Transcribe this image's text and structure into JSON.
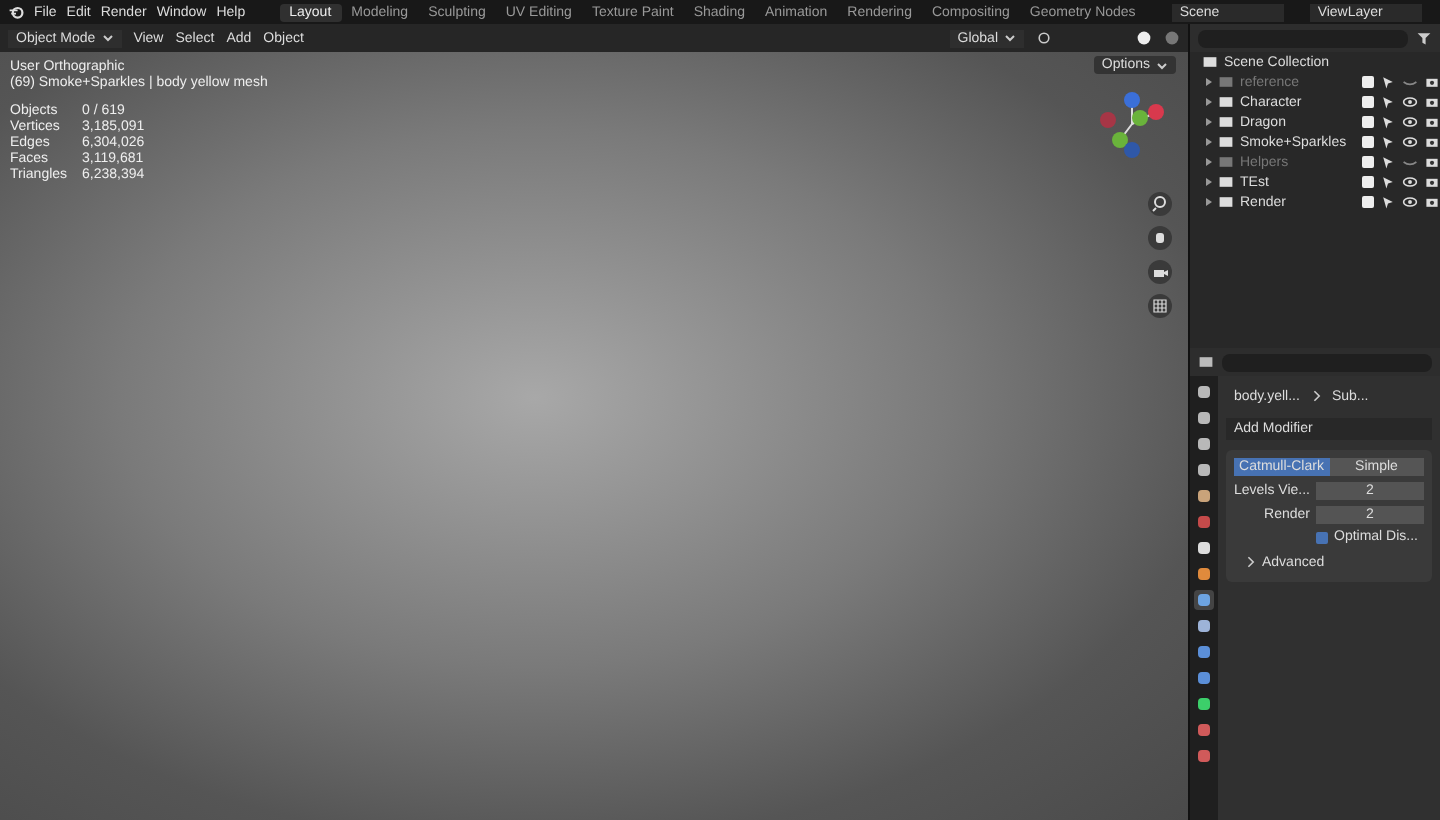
{
  "menu": [
    "File",
    "Edit",
    "Render",
    "Window",
    "Help"
  ],
  "workspaces": [
    {
      "label": "Layout",
      "selected": true
    },
    {
      "label": "Modeling",
      "selected": false
    },
    {
      "label": "Sculpting",
      "selected": false
    },
    {
      "label": "UV Editing",
      "selected": false
    },
    {
      "label": "Texture Paint",
      "selected": false
    },
    {
      "label": "Shading",
      "selected": false
    },
    {
      "label": "Animation",
      "selected": false
    },
    {
      "label": "Rendering",
      "selected": false
    },
    {
      "label": "Compositing",
      "selected": false
    },
    {
      "label": "Geometry Nodes",
      "selected": false
    }
  ],
  "scene": {
    "label": "Scene"
  },
  "view_layer": {
    "label": "ViewLayer"
  },
  "header": {
    "mode": "Object Mode",
    "menus": [
      "View",
      "Select",
      "Add",
      "Object"
    ],
    "orientation": "Global"
  },
  "viewport": {
    "view_name": "User Orthographic",
    "object_info": "(69) Smoke+Sparkles | body yellow mesh",
    "options": "Options",
    "stats": [
      {
        "label": "Objects",
        "value": "0 / 619"
      },
      {
        "label": "Vertices",
        "value": "3,185,091"
      },
      {
        "label": "Edges",
        "value": "6,304,026"
      },
      {
        "label": "Faces",
        "value": "3,119,681"
      },
      {
        "label": "Triangles",
        "value": "6,238,394"
      }
    ]
  },
  "outliner": {
    "root": "Scene Collection",
    "items": [
      {
        "name": "reference",
        "dimmed": true,
        "checked": true,
        "visible": false
      },
      {
        "name": "Character",
        "dimmed": false,
        "checked": true,
        "visible": true
      },
      {
        "name": "Dragon",
        "dimmed": false,
        "checked": true,
        "visible": true
      },
      {
        "name": "Smoke+Sparkles",
        "dimmed": false,
        "checked": true,
        "visible": true
      },
      {
        "name": "Helpers",
        "dimmed": true,
        "checked": true,
        "visible": false
      },
      {
        "name": "TEst",
        "dimmed": false,
        "checked": true,
        "visible": true
      },
      {
        "name": "Render",
        "dimmed": false,
        "checked": true,
        "visible": true
      }
    ]
  },
  "properties": {
    "tabs": [
      {
        "kind": "tool",
        "selected": false
      },
      {
        "kind": "render",
        "selected": false
      },
      {
        "kind": "output",
        "selected": false
      },
      {
        "kind": "view",
        "selected": false
      },
      {
        "kind": "scene",
        "selected": false
      },
      {
        "kind": "world",
        "selected": false
      },
      {
        "kind": "collection",
        "selected": false
      },
      {
        "kind": "object",
        "selected": false
      },
      {
        "kind": "modifier",
        "selected": true
      },
      {
        "kind": "particles",
        "selected": false
      },
      {
        "kind": "physics",
        "selected": false
      },
      {
        "kind": "constraints",
        "selected": false
      },
      {
        "kind": "data",
        "selected": false
      },
      {
        "kind": "material",
        "selected": false
      },
      {
        "kind": "texture",
        "selected": false
      }
    ],
    "breadcrumb": [
      "body.yell...",
      "Sub..."
    ],
    "add_modifier": "Add Modifier",
    "modes": [
      {
        "label": "Catmull-Clark",
        "selected": true
      },
      {
        "label": "Simple",
        "selected": false
      }
    ],
    "fields": [
      {
        "label": "Levels Vie...",
        "value": "2"
      },
      {
        "label": "Render",
        "value": "2"
      }
    ],
    "optimal": {
      "label": "Optimal Dis...",
      "checked": true
    },
    "advanced": {
      "label": "Advanced",
      "expanded": false
    }
  }
}
